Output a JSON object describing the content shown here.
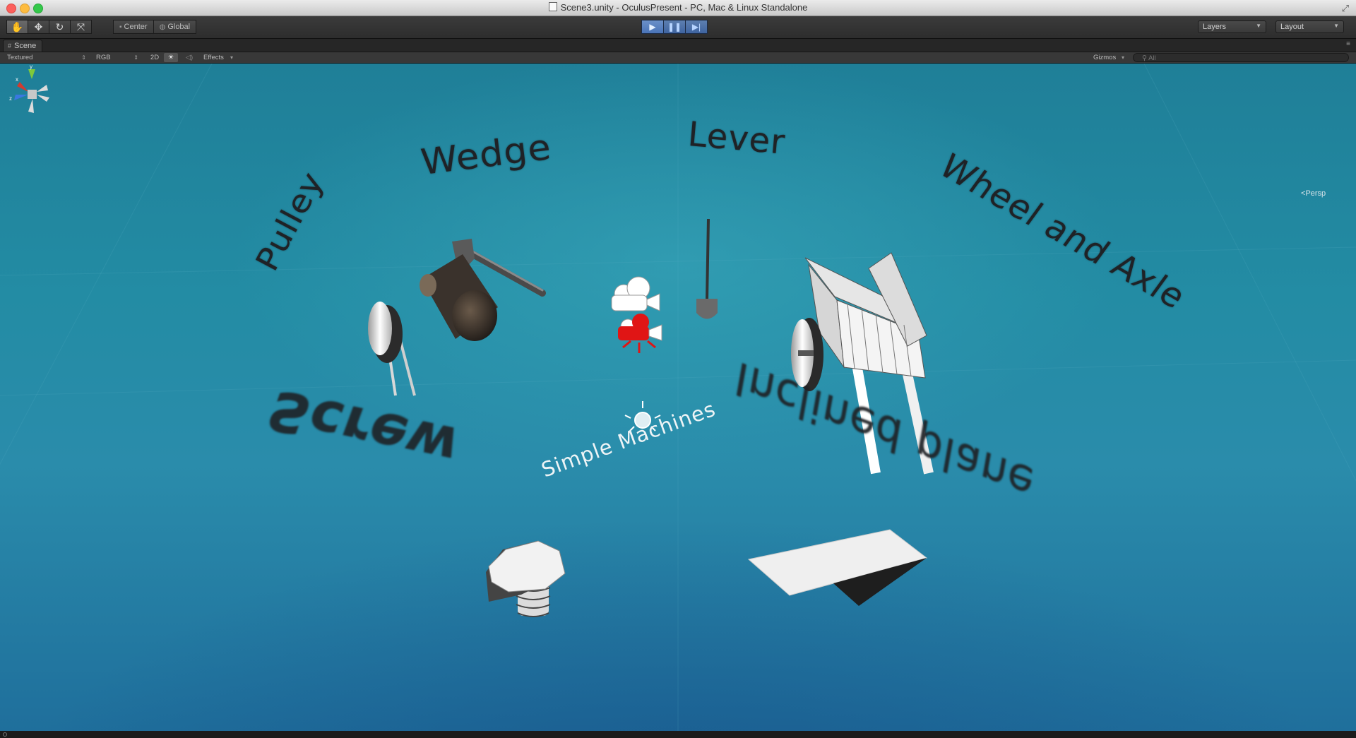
{
  "window": {
    "title": "Scene3.unity - OculusPresent - PC, Mac & Linux Standalone"
  },
  "toolbar": {
    "tools": [
      {
        "name": "hand-tool",
        "glyph": "✋"
      },
      {
        "name": "move-tool",
        "glyph": "✥"
      },
      {
        "name": "rotate-tool",
        "glyph": "↻"
      },
      {
        "name": "scale-tool",
        "glyph": "⤧"
      }
    ],
    "pivot_label": "Center",
    "space_label": "Global",
    "play": {
      "play_glyph": "▶",
      "pause_glyph": "❚❚",
      "step_glyph": "▶|"
    },
    "layers_label": "Layers",
    "layout_label": "Layout"
  },
  "scene_tab": {
    "label": "Scene"
  },
  "scene_bar": {
    "draw_mode": "Textured",
    "render_mode": "RGB",
    "mode_2d": "2D",
    "lighting_glyph": "☀",
    "audio_glyph": "◁)",
    "effects_label": "Effects",
    "gizmos_label": "Gizmos",
    "search_placeholder": "All"
  },
  "scene": {
    "labels": {
      "wedge": "Wedge",
      "lever": "Lever",
      "pulley": "Pulley",
      "wheel_axle": "Wheel and Axle",
      "screw": "Screw",
      "inclined_plane": "Inclined plane",
      "simple_machines": "Simple Machines"
    },
    "gizmo": {
      "x_axis": "x",
      "y_axis": "y",
      "z_axis": "z",
      "projection": "Persp"
    },
    "colors": {
      "ocean": "#238ca4",
      "camera_red": "#e01515",
      "axis_x": "#d23a2e",
      "axis_y": "#7ec83a",
      "axis_z": "#3a78e0"
    }
  }
}
